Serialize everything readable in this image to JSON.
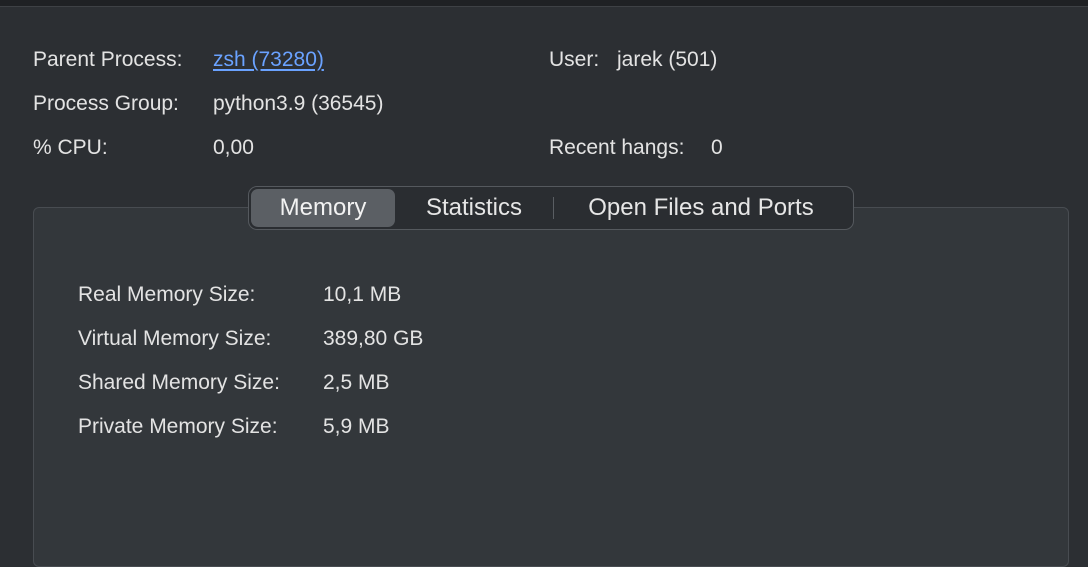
{
  "info": {
    "parent_process_label": "Parent Process:",
    "parent_process_value": "zsh (73280)",
    "process_group_label": "Process Group:",
    "process_group_value": "python3.9 (36545)",
    "cpu_label": "% CPU:",
    "cpu_value": "0,00",
    "user_label": "User:",
    "user_value": "jarek (501)",
    "recent_hangs_label": "Recent hangs:",
    "recent_hangs_value": "0"
  },
  "tabs": {
    "memory": "Memory",
    "statistics": "Statistics",
    "open_files": "Open Files and Ports",
    "active": "Memory"
  },
  "memory": {
    "real_label": "Real Memory Size:",
    "real_value": "10,1 MB",
    "virtual_label": "Virtual Memory Size:",
    "virtual_value": "389,80 GB",
    "shared_label": "Shared Memory Size:",
    "shared_value": "2,5 MB",
    "private_label": "Private Memory Size:",
    "private_value": "5,9 MB"
  },
  "colors": {
    "background": "#2c2f33",
    "panel": "#33373b",
    "link": "#6aa2ff",
    "active_tab": "#5b5f64"
  }
}
